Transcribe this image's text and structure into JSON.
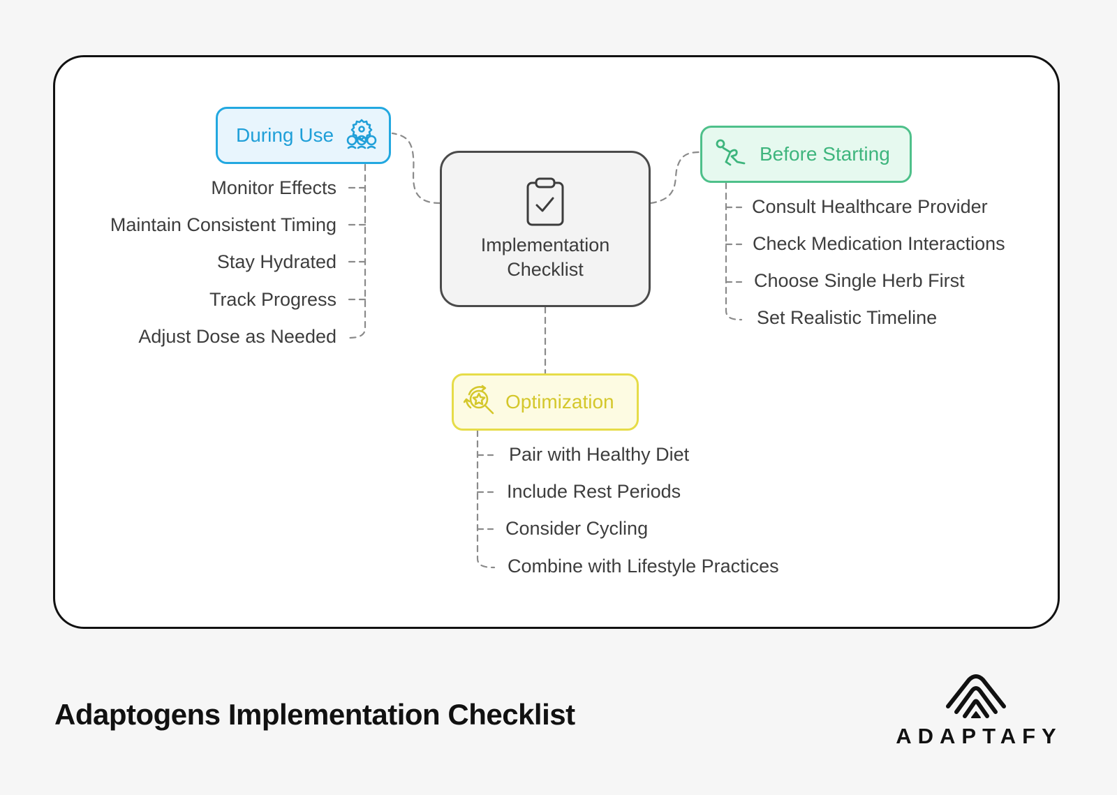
{
  "diagram": {
    "center": {
      "label": "Implementation Checklist",
      "icon": "clipboard-check-icon"
    },
    "branches": [
      {
        "id": "during-use",
        "label": "During Use",
        "icon": "team-settings-icon",
        "color": "#1f9fd8",
        "items": [
          "Monitor Effects",
          "Maintain Consistent Timing",
          "Stay Hydrated",
          "Track Progress",
          "Adjust Dose as Needed"
        ]
      },
      {
        "id": "before-starting",
        "label": "Before Starting",
        "icon": "starting-runner-icon",
        "color": "#3eb57d",
        "items": [
          "Consult Healthcare Provider",
          "Check Medication Interactions",
          "Choose Single Herb First",
          "Set Realistic Timeline"
        ]
      },
      {
        "id": "optimization",
        "label": "Optimization",
        "icon": "star-search-cycle-icon",
        "color": "#d4c72b",
        "items": [
          "Pair with Healthy Diet",
          "Include Rest Periods",
          "Consider Cycling",
          "Combine with Lifestyle Practices"
        ]
      }
    ]
  },
  "footer": {
    "title": "Adaptogens Implementation Checklist",
    "brand": "ADAPTAFY"
  }
}
